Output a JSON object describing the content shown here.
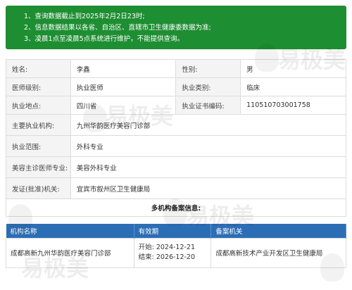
{
  "notice": {
    "lines": [
      "1、查询数据截止到2025年2月2日23时;",
      "2、信息数据结果以各省、自治区、直辖市卫生健康委数据为准;",
      "3、凌晨1点至凌晨5点系统进行维护，不能提供查询。"
    ]
  },
  "info": {
    "name_label": "姓名:",
    "name_value": "李鑫",
    "gender_label": "性别:",
    "gender_value": "男",
    "level_label": "医师级别:",
    "level_value": "执业医师",
    "category_label": "执业类别:",
    "category_value": "临床",
    "location_label": "执业地点:",
    "location_value": "四川省",
    "cert_label": "执业证书编码:",
    "cert_value": "110510703001758",
    "org_label": "主要执业机构:",
    "org_value": "九州华韵医疗美容门诊部",
    "scope_label": "执业范围:",
    "scope_value": "外科专业",
    "cosmetic_label": "美容主诊医师专业:",
    "cosmetic_value": "美容外科专业",
    "issuer_label": "发证(批准)机关:",
    "issuer_value": "宜宾市叙州区卫生健康局",
    "multi_title": "多机构备案信息:"
  },
  "institutions": {
    "headers": [
      "机构名称",
      "有效期",
      "备案机关"
    ],
    "rows": [
      {
        "name": "成都高新九州华韵医疗美容门诊部",
        "start": "开始: 2024-12-21",
        "end": "结束: 2026-12-20",
        "authority": "成都高新技术产业开发区卫生健康局"
      }
    ]
  },
  "watermark": {
    "text": "易极美"
  },
  "colors": {
    "notice_bg": "#1e8e32",
    "table_header_bg": "#2c6eb6"
  }
}
